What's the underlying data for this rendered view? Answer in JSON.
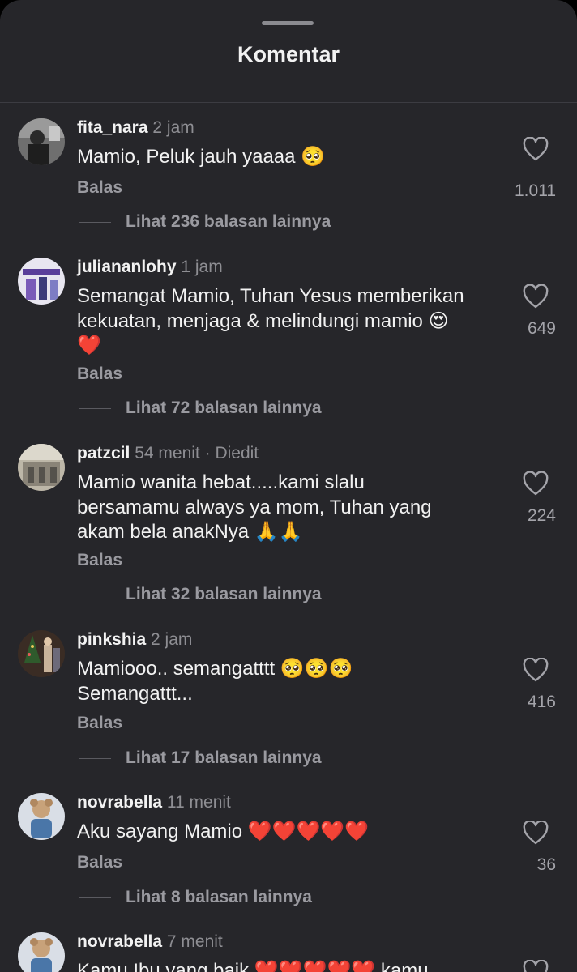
{
  "header": {
    "title": "Komentar"
  },
  "reply_label": "Balas",
  "comments": [
    {
      "username": "fita_nara",
      "time": "2 jam",
      "edited": "",
      "lines": [
        "Mamio, Peluk jauh yaaaa 🥺"
      ],
      "likes": "1.011",
      "view_replies": "Lihat 236 balasan lainnya"
    },
    {
      "username": "juliananlohy",
      "time": "1 jam",
      "edited": "",
      "lines": [
        "Semangat Mamio, Tuhan Yesus memberikan",
        "kekuatan, menjaga & melindungi mamio 😍",
        "❤️"
      ],
      "likes": "649",
      "view_replies": "Lihat 72 balasan lainnya"
    },
    {
      "username": "patzcil",
      "time": "54 menit",
      "edited": "Diedit",
      "lines": [
        "Mamio wanita hebat.....kami slalu",
        "bersamamu always ya mom, Tuhan yang",
        "akam bela anakNya 🙏🙏"
      ],
      "likes": "224",
      "view_replies": "Lihat 32 balasan lainnya"
    },
    {
      "username": "pinkshia",
      "time": "2 jam",
      "edited": "",
      "lines": [
        "Mamiooo.. semangatttt 🥺🥺🥺",
        "Semangattt..."
      ],
      "likes": "416",
      "view_replies": "Lihat 17 balasan lainnya"
    },
    {
      "username": "novrabella",
      "time": "11 menit",
      "edited": "",
      "lines": [
        "Aku sayang Mamio ❤️❤️❤️❤️❤️"
      ],
      "likes": "36",
      "view_replies": "Lihat 8 balasan lainnya"
    },
    {
      "username": "novrabella",
      "time": "7 menit",
      "edited": "",
      "lines": [
        "Kamu Ibu yang baik ❤️❤️❤️❤️❤️ kamu"
      ],
      "likes": "",
      "view_replies": ""
    }
  ],
  "icons": {
    "like": "heart-outline-icon"
  },
  "colors": {
    "background": "#26262a",
    "text": "#f2f2f2",
    "muted": "#8e8e93"
  }
}
